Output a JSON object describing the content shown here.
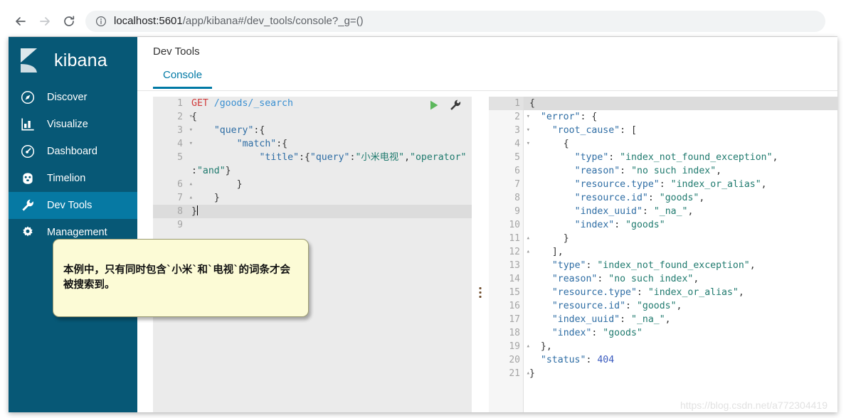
{
  "browser": {
    "back_icon": "back-arrow-icon",
    "forward_icon": "forward-arrow-icon",
    "reload_icon": "reload-icon",
    "info_icon": "info-circle-icon",
    "url_host": "localhost:5601",
    "url_path": "/app/kibana#/dev_tools/console?_g=()"
  },
  "sidebar": {
    "brand": "kibana",
    "brand_color": "#075876",
    "active_color": "#0679a3",
    "items": [
      {
        "label": "Discover",
        "icon": "compass-icon",
        "active": false
      },
      {
        "label": "Visualize",
        "icon": "bar-chart-icon",
        "active": false
      },
      {
        "label": "Dashboard",
        "icon": "dashboard-icon",
        "active": false
      },
      {
        "label": "Timelion",
        "icon": "timelion-icon",
        "active": false
      },
      {
        "label": "Dev Tools",
        "icon": "wrench-icon",
        "active": true
      },
      {
        "label": "Management",
        "icon": "gear-icon",
        "active": false
      }
    ]
  },
  "main": {
    "page_title": "Dev Tools",
    "tabs": [
      {
        "label": "Console",
        "active": true
      }
    ],
    "accent_color": "#0079a5"
  },
  "editor": {
    "run_icon": "play-triangle-icon",
    "wrench_icon": "wrench-icon",
    "active_line": 8,
    "lines": [
      {
        "n": 1,
        "fold": "",
        "text": "GET /goods/_search"
      },
      {
        "n": 2,
        "fold": "▾",
        "text": "{"
      },
      {
        "n": 3,
        "fold": "▾",
        "text": "    \"query\":{"
      },
      {
        "n": 4,
        "fold": "▾",
        "text": "        \"match\":{"
      },
      {
        "n": 5,
        "fold": "",
        "text": "            \"title\":{\"query\":\"小米电视\",\"operator\""
      },
      {
        "n": "",
        "fold": "",
        "text": ":\"and\"}"
      },
      {
        "n": 6,
        "fold": "▴",
        "text": "        }"
      },
      {
        "n": 7,
        "fold": "▴",
        "text": "    }"
      },
      {
        "n": 8,
        "fold": "▴",
        "text": "}"
      },
      {
        "n": 9,
        "fold": "",
        "text": ""
      }
    ]
  },
  "response": {
    "active_line": 1,
    "lines": [
      {
        "n": 1,
        "fold": "▾",
        "text": "{"
      },
      {
        "n": 2,
        "fold": "▾",
        "text": "  \"error\": {"
      },
      {
        "n": 3,
        "fold": "▾",
        "text": "    \"root_cause\": ["
      },
      {
        "n": 4,
        "fold": "▾",
        "text": "      {"
      },
      {
        "n": 5,
        "fold": "",
        "text": "        \"type\": \"index_not_found_exception\","
      },
      {
        "n": 6,
        "fold": "",
        "text": "        \"reason\": \"no such index\","
      },
      {
        "n": 7,
        "fold": "",
        "text": "        \"resource.type\": \"index_or_alias\","
      },
      {
        "n": 8,
        "fold": "",
        "text": "        \"resource.id\": \"goods\","
      },
      {
        "n": 9,
        "fold": "",
        "text": "        \"index_uuid\": \"_na_\","
      },
      {
        "n": 10,
        "fold": "",
        "text": "        \"index\": \"goods\""
      },
      {
        "n": 11,
        "fold": "▴",
        "text": "      }"
      },
      {
        "n": 12,
        "fold": "▴",
        "text": "    ],"
      },
      {
        "n": 13,
        "fold": "",
        "text": "    \"type\": \"index_not_found_exception\","
      },
      {
        "n": 14,
        "fold": "",
        "text": "    \"reason\": \"no such index\","
      },
      {
        "n": 15,
        "fold": "",
        "text": "    \"resource.type\": \"index_or_alias\","
      },
      {
        "n": 16,
        "fold": "",
        "text": "    \"resource.id\": \"goods\","
      },
      {
        "n": 17,
        "fold": "",
        "text": "    \"index_uuid\": \"_na_\","
      },
      {
        "n": 18,
        "fold": "",
        "text": "    \"index\": \"goods\""
      },
      {
        "n": 19,
        "fold": "▴",
        "text": "  },"
      },
      {
        "n": 20,
        "fold": "",
        "text": "  \"status\": 404"
      },
      {
        "n": 21,
        "fold": "▴",
        "text": "}"
      }
    ]
  },
  "annotation": {
    "text": "本例中，只有同时包含`小米`和`电视`的词条才会被搜索到。"
  },
  "watermark": {
    "text": "https://blog.csdn.net/a772304419"
  }
}
